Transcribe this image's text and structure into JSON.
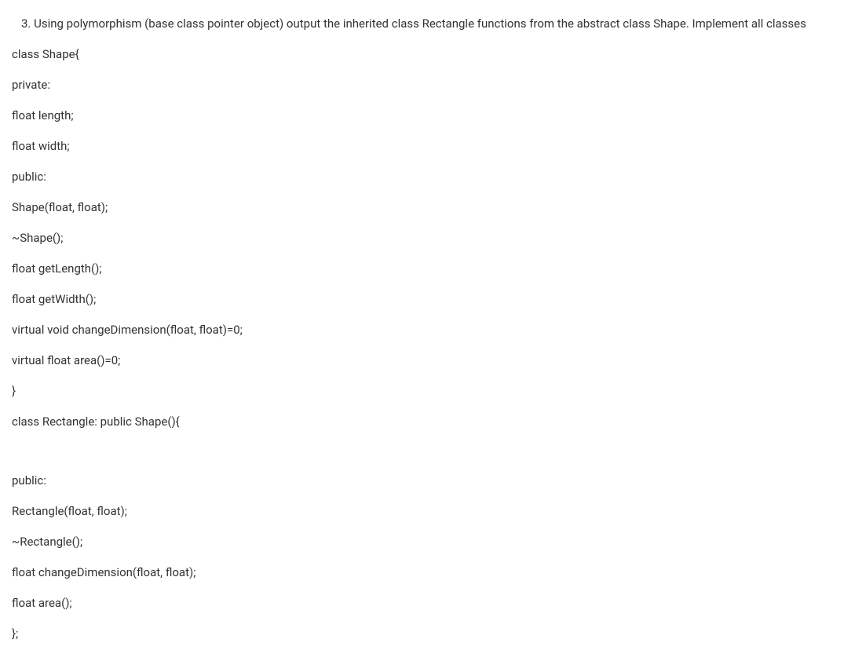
{
  "question": {
    "number": "3.",
    "text": "Using polymorphism (base class pointer object) output the inherited class Rectangle functions from the abstract class Shape. Implement all classes"
  },
  "code_lines": [
    "class Shape{",
    "private:",
    "float length;",
    "float width;",
    "public:",
    "Shape(float, float);",
    "~Shape();",
    "float getLength();",
    "float getWidth();",
    "virtual void changeDimension(float, float)=0;",
    "virtual float area()=0;",
    "}",
    "class Rectangle: public Shape(){",
    "",
    "public:",
    "Rectangle(float, float);",
    "~Rectangle();",
    "float changeDimension(float, float);",
    "float area();",
    "};"
  ]
}
